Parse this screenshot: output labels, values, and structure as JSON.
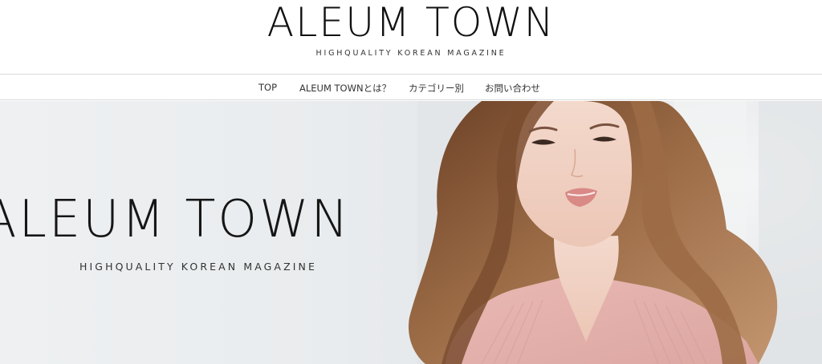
{
  "header": {
    "site_title": "ALEUM TOWN",
    "tagline": "HIGHQUALITY KOREAN MAGAZINE"
  },
  "nav": {
    "items": [
      {
        "label": "TOP"
      },
      {
        "label": "ALEUM TOWNとは？"
      },
      {
        "label": "カテゴリー別"
      },
      {
        "label": "お問い合わせ"
      }
    ]
  },
  "hero": {
    "title": "ALEUM TOWN",
    "tagline": "HIGHQUALITY KOREAN MAGAZINE"
  },
  "colors": {
    "text": "#111111",
    "border": "#d9d9d9",
    "hero_background": "#eceef0",
    "sweater": "#e5b2ae",
    "hair": "#8a5a38"
  }
}
